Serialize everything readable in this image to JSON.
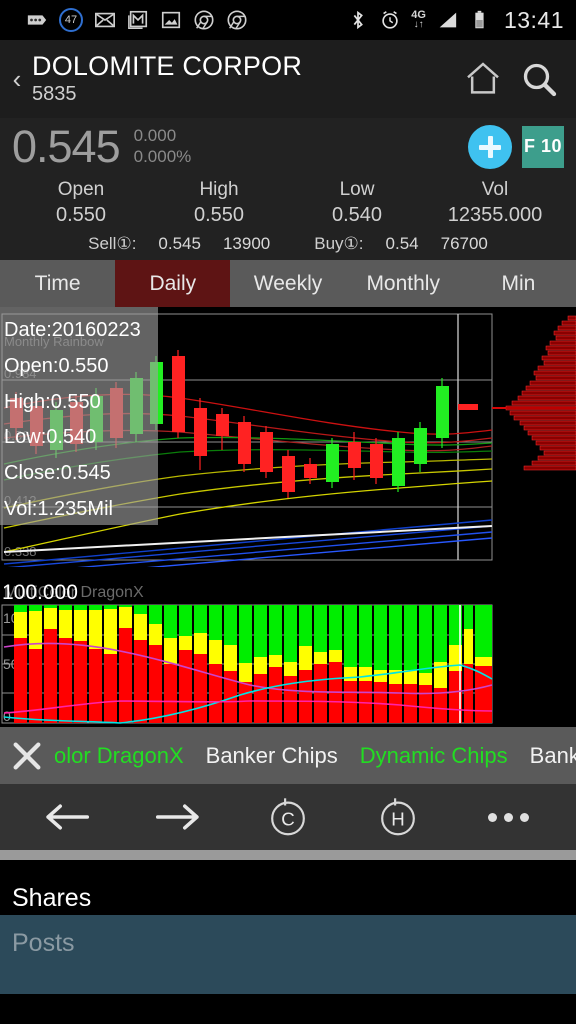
{
  "statusbar": {
    "icons": [
      "more-dots-icon",
      "notification-count-badge",
      "mail-icon",
      "gmail-icon",
      "photos-icon",
      "chrome-icon",
      "chrome-icon-2"
    ],
    "notification_count": "47",
    "network": "4G",
    "time": "13:41",
    "right_icons": [
      "bluetooth-icon",
      "alarm-icon",
      "network-4g-icon",
      "signal-bars-icon",
      "battery-icon"
    ]
  },
  "header": {
    "back": "‹",
    "title": "DOLOMITE CORPOR",
    "code": "5835",
    "home_icon": "home-icon",
    "search_icon": "search-icon"
  },
  "quote": {
    "price": "0.545",
    "change": "0.000",
    "change_pct": "0.000%",
    "add_label": "+",
    "f10_label": "F 10",
    "fields": [
      {
        "label": "Open",
        "value": "0.550"
      },
      {
        "label": "High",
        "value": "0.550"
      },
      {
        "label": "Low",
        "value": "0.540"
      },
      {
        "label": "Vol",
        "value": "12355.000"
      }
    ],
    "sell_label": "Sell①:",
    "sell_price": "0.545",
    "sell_qty": "13900",
    "buy_label": "Buy①:",
    "buy_price": "0.54",
    "buy_qty": "76700"
  },
  "tabs": {
    "items": [
      "Time",
      "Daily",
      "Weekly",
      "Monthly",
      "Min"
    ],
    "active": "Daily",
    "active_color": "#5e1414"
  },
  "tooltip": {
    "date": "Date:20160223",
    "open": "Open:0.550",
    "high": "High:0.550",
    "low": "Low:0.540",
    "close": "Close:0.545",
    "vol": "Vol:1.235Mil"
  },
  "chart_overlay": {
    "main_title": "Monthly Rainbow",
    "sub_title": "MultiColor DragonX",
    "sub_value": "100.000",
    "price_labels": [
      "0.984",
      "0.568",
      "0.412",
      "0.338"
    ],
    "sub_axis": [
      "100",
      "50",
      "0"
    ]
  },
  "legend": {
    "close_icon": "close-icon",
    "items": [
      {
        "label": "olor DragonX",
        "active": true
      },
      {
        "label": "Banker Chips",
        "active": false
      },
      {
        "label": "Dynamic Chips",
        "active": true
      },
      {
        "label": "Banker",
        "active": false
      }
    ],
    "active_color": "#22dd22",
    "inactive_color": "#f2f2f2"
  },
  "navbar": {
    "items": [
      "back-arrow-icon",
      "forward-arrow-icon",
      "c-circle-icon",
      "h-circle-icon",
      "more-dots-icon"
    ],
    "c_label": "C",
    "h_label": "H"
  },
  "bottom": {
    "shares": "Shares",
    "posts": "Posts",
    "posts_bg": "#2c4a5a"
  },
  "chart_data": {
    "type": "candlestick",
    "title": "Monthly Rainbow",
    "ylim": [
      0.3,
      1.02
    ],
    "price_gridlines": [
      0.984,
      0.568,
      0.412,
      0.338
    ],
    "candles": [
      {
        "o": 0.62,
        "h": 0.66,
        "l": 0.6,
        "c": 0.61,
        "dir": "down"
      },
      {
        "o": 0.61,
        "h": 0.63,
        "l": 0.55,
        "c": 0.56,
        "dir": "down"
      },
      {
        "o": 0.56,
        "h": 0.6,
        "l": 0.54,
        "c": 0.59,
        "dir": "up"
      },
      {
        "o": 0.59,
        "h": 0.63,
        "l": 0.56,
        "c": 0.57,
        "dir": "down"
      },
      {
        "o": 0.57,
        "h": 0.62,
        "l": 0.55,
        "c": 0.61,
        "dir": "up"
      },
      {
        "o": 0.61,
        "h": 0.66,
        "l": 0.58,
        "c": 0.59,
        "dir": "down"
      },
      {
        "o": 0.59,
        "h": 0.62,
        "l": 0.55,
        "c": 0.61,
        "dir": "up"
      },
      {
        "o": 0.61,
        "h": 0.7,
        "l": 0.59,
        "c": 0.69,
        "dir": "up"
      },
      {
        "o": 0.71,
        "h": 0.73,
        "l": 0.6,
        "c": 0.62,
        "dir": "down"
      },
      {
        "o": 0.62,
        "h": 0.63,
        "l": 0.57,
        "c": 0.58,
        "dir": "down"
      },
      {
        "o": 0.59,
        "h": 0.6,
        "l": 0.57,
        "c": 0.58,
        "dir": "down"
      },
      {
        "o": 0.58,
        "h": 0.59,
        "l": 0.53,
        "c": 0.55,
        "dir": "down"
      },
      {
        "o": 0.55,
        "h": 0.57,
        "l": 0.52,
        "c": 0.53,
        "dir": "down"
      },
      {
        "o": 0.53,
        "h": 0.54,
        "l": 0.47,
        "c": 0.48,
        "dir": "down"
      },
      {
        "o": 0.48,
        "h": 0.52,
        "l": 0.47,
        "c": 0.5,
        "dir": "down"
      },
      {
        "o": 0.5,
        "h": 0.55,
        "l": 0.48,
        "c": 0.54,
        "dir": "up"
      },
      {
        "o": 0.54,
        "h": 0.56,
        "l": 0.5,
        "c": 0.52,
        "dir": "down"
      },
      {
        "o": 0.52,
        "h": 0.54,
        "l": 0.49,
        "c": 0.5,
        "dir": "down"
      },
      {
        "o": 0.5,
        "h": 0.56,
        "l": 0.48,
        "c": 0.55,
        "dir": "up"
      },
      {
        "o": 0.55,
        "h": 0.57,
        "l": 0.52,
        "c": 0.53,
        "dir": "down"
      },
      {
        "o": 0.53,
        "h": 0.56,
        "l": 0.51,
        "c": 0.55,
        "dir": "up"
      },
      {
        "o": 0.55,
        "h": 0.62,
        "l": 0.54,
        "c": 0.61,
        "dir": "up"
      },
      {
        "o": 0.61,
        "h": 0.63,
        "l": 0.57,
        "c": 0.58,
        "dir": "down"
      },
      {
        "o": 0.545,
        "h": 0.55,
        "l": 0.54,
        "c": 0.545,
        "dir": "down"
      }
    ],
    "ma_bands": 8,
    "volume_profile": {
      "orientation": "horizontal",
      "color": "#8b0000",
      "bars": [
        0.1,
        0.16,
        0.22,
        0.26,
        0.3,
        0.34,
        0.4,
        0.44,
        0.5,
        0.54,
        0.58,
        0.62,
        0.68,
        0.74,
        0.82,
        0.88,
        0.96,
        1.0,
        0.92,
        0.84,
        0.76,
        0.7,
        0.64,
        0.58,
        0.52,
        0.46,
        0.42,
        0.38,
        0.34,
        0.48,
        0.52
      ]
    },
    "sub_chart": {
      "type": "stacked-bar",
      "title": "MultiColor DragonX",
      "ylim": [
        0,
        100
      ],
      "yticks": [
        0,
        50,
        100
      ],
      "colors": {
        "red": "#ff0000",
        "yellow": "#ffff00",
        "green": "#00ee00"
      },
      "series": [
        {
          "name": "red",
          "values": [
            72,
            63,
            80,
            72,
            70,
            63,
            58,
            80,
            70,
            66,
            50,
            62,
            58,
            50,
            44,
            35,
            42,
            48,
            40,
            45,
            50,
            52,
            36,
            36,
            35,
            33,
            33,
            32,
            30,
            44,
            50,
            48
          ]
        },
        {
          "name": "yellow",
          "values": [
            22,
            32,
            18,
            24,
            26,
            33,
            38,
            18,
            22,
            18,
            22,
            12,
            18,
            20,
            22,
            16,
            14,
            10,
            12,
            20,
            10,
            10,
            12,
            12,
            10,
            12,
            12,
            10,
            22,
            22,
            30,
            8
          ]
        },
        {
          "name": "green",
          "values": [
            6,
            5,
            2,
            4,
            4,
            4,
            4,
            2,
            8,
            16,
            28,
            26,
            24,
            30,
            34,
            49,
            44,
            42,
            48,
            35,
            40,
            38,
            52,
            52,
            55,
            55,
            55,
            58,
            48,
            34,
            20,
            44
          ]
        }
      ],
      "lines": [
        {
          "name": "purple",
          "color": "#cc44cc"
        },
        {
          "name": "cyan",
          "color": "#00e5e5"
        },
        {
          "name": "magenta",
          "color": "#ff22aa"
        }
      ]
    }
  }
}
